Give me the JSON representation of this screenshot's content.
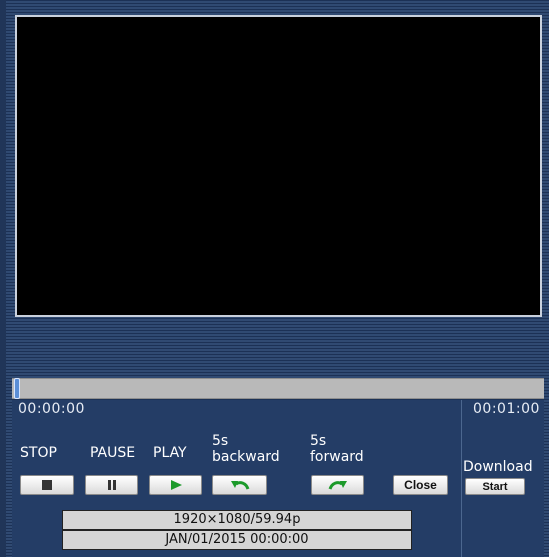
{
  "player": {
    "time_start": "00:00:00",
    "time_end": "00:01:00",
    "seek_position": 0
  },
  "controls": {
    "stop_label": "STOP",
    "pause_label": "PAUSE",
    "play_label": "PLAY",
    "backward_label_line1": "5s",
    "backward_label_line2": "backward",
    "forward_label_line1": "5s",
    "forward_label_line2": "forward",
    "close_label": "Close",
    "download_label": "Download",
    "start_label": "Start"
  },
  "info": {
    "resolution": "1920×1080/59.94p",
    "datetime": "JAN/01/2015 00:00:00"
  },
  "icons": {
    "stop": "stop-icon",
    "pause": "pause-icon",
    "play": "play-icon",
    "backward": "rewind-arrow-icon",
    "forward": "forward-arrow-icon"
  },
  "colors": {
    "panel_bg": "#243d66",
    "icon_green": "#1c9a2a",
    "video_bg": "#000000"
  }
}
